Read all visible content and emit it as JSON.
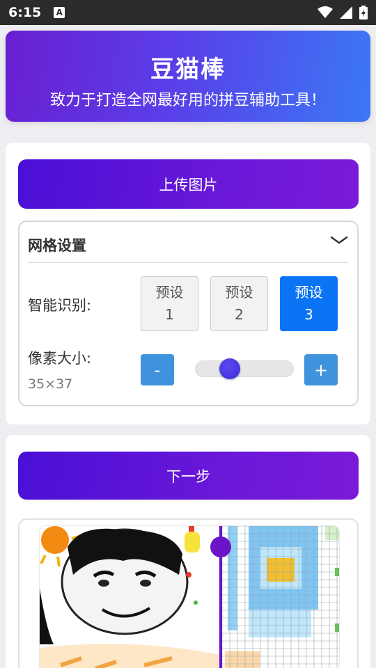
{
  "status": {
    "time": "6:15",
    "notif_glyph": "A"
  },
  "header": {
    "title": "豆猫棒",
    "subtitle": "致力于打造全网最好用的拼豆辅助工具！"
  },
  "upload": {
    "label": "上传图片"
  },
  "grid_settings": {
    "title": "网格设置",
    "smart_label": "智能识别:",
    "presets": [
      {
        "line1": "预设",
        "line2": "1",
        "active": false
      },
      {
        "line1": "预设",
        "line2": "2",
        "active": false
      },
      {
        "line1": "预设",
        "line2": "3",
        "active": true
      }
    ],
    "pixel_label": "像素大小:",
    "pixel_value": "35×37",
    "minus": "-",
    "plus": "+",
    "slider_fraction": 0.3
  },
  "next": {
    "label": "下一步"
  },
  "colors": {
    "accent": "#0a74f5",
    "step_button": "#3f93dc",
    "banner_start": "#6a1fd1",
    "banner_end": "#3a78f5"
  }
}
